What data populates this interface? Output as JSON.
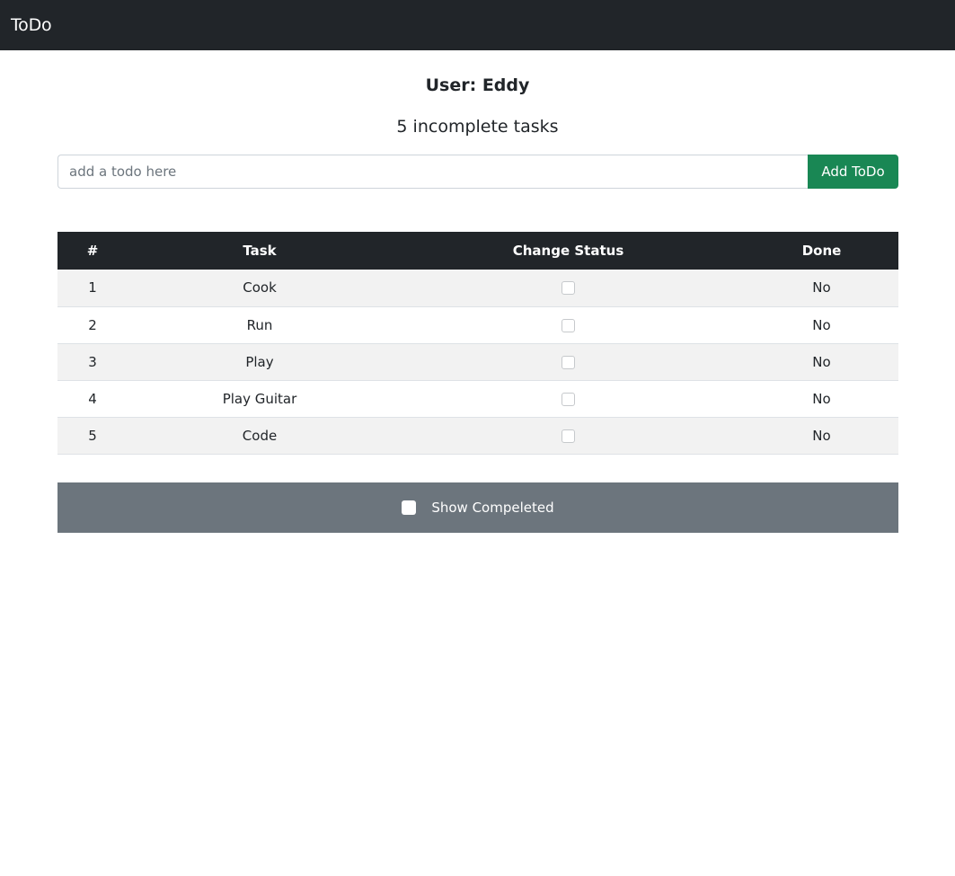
{
  "navbar": {
    "brand": "ToDo"
  },
  "user": {
    "heading": "User: Eddy"
  },
  "summary": {
    "incomplete_text": "5 incomplete tasks"
  },
  "add_form": {
    "placeholder": "add a todo here",
    "value": "",
    "button_label": "Add ToDo"
  },
  "table": {
    "headers": [
      "#",
      "Task",
      "Change Status",
      "Done"
    ],
    "rows": [
      {
        "num": "1",
        "task": "Cook",
        "checked": false,
        "done": "No"
      },
      {
        "num": "2",
        "task": "Run",
        "checked": false,
        "done": "No"
      },
      {
        "num": "3",
        "task": "Play",
        "checked": false,
        "done": "No"
      },
      {
        "num": "4",
        "task": "Play Guitar",
        "checked": false,
        "done": "No"
      },
      {
        "num": "5",
        "task": "Code",
        "checked": false,
        "done": "No"
      }
    ]
  },
  "footer": {
    "toggle_label": "Show Compeleted",
    "toggle_checked": false
  },
  "colors": {
    "navbar": "#212529",
    "add_button": "#198754",
    "footer_bar": "#6c757d",
    "row_stripe": "#f2f2f2"
  }
}
